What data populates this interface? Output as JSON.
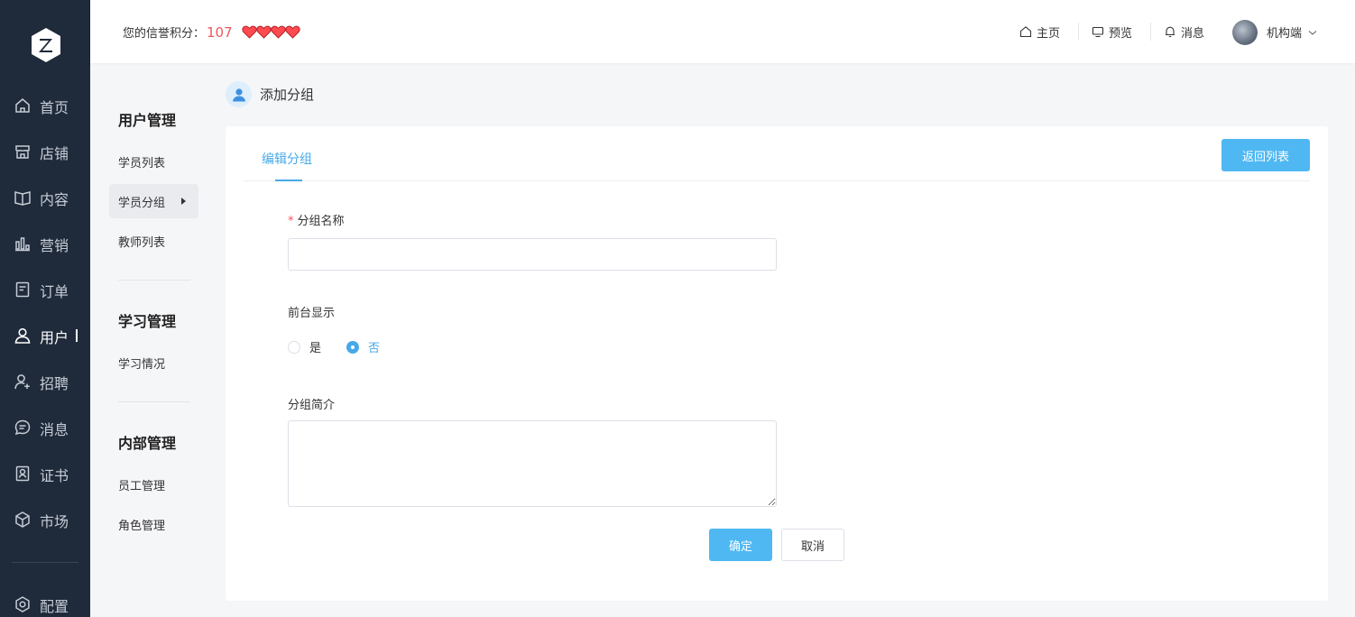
{
  "sidebar": {
    "items": [
      {
        "label": "首页",
        "icon": "home-icon"
      },
      {
        "label": "店铺",
        "icon": "store-icon"
      },
      {
        "label": "内容",
        "icon": "book-icon"
      },
      {
        "label": "营销",
        "icon": "chart-bars-icon"
      },
      {
        "label": "订单",
        "icon": "document-icon"
      },
      {
        "label": "用户",
        "icon": "user-icon",
        "active": true
      },
      {
        "label": "招聘",
        "icon": "user-add-icon"
      },
      {
        "label": "消息",
        "icon": "chat-icon"
      },
      {
        "label": "证书",
        "icon": "certificate-icon"
      },
      {
        "label": "市场",
        "icon": "cube-icon"
      },
      {
        "label": "配置",
        "icon": "gear-icon"
      }
    ]
  },
  "header": {
    "credit_label": "您的信誉积分：",
    "credit_value": "107",
    "nav": [
      {
        "label": "主页",
        "icon": "home-icon"
      },
      {
        "label": "预览",
        "icon": "monitor-icon"
      },
      {
        "label": "消息",
        "icon": "bell-icon"
      }
    ],
    "user_name": "机构端"
  },
  "submenu": {
    "groups": [
      {
        "title": "用户管理",
        "items": [
          "学员列表",
          "学员分组",
          "教师列表"
        ]
      },
      {
        "title": "学习管理",
        "items": [
          "学习情况"
        ]
      },
      {
        "title": "内部管理",
        "items": [
          "员工管理",
          "角色管理"
        ]
      }
    ],
    "active_item": "学员分组"
  },
  "page": {
    "title": "添加分组",
    "tab": "编辑分组",
    "back_button": "返回列表"
  },
  "form": {
    "name_label": "分组名称",
    "name_value": "",
    "display_label": "前台显示",
    "display_options": [
      "是",
      "否"
    ],
    "display_selected": "否",
    "intro_label": "分组简介",
    "intro_value": "",
    "ok_button": "确定",
    "cancel_button": "取消"
  },
  "colors": {
    "sidebar_bg": "#1f2a3a",
    "accent": "#4fb8f3",
    "credit_red": "#f0575c"
  }
}
